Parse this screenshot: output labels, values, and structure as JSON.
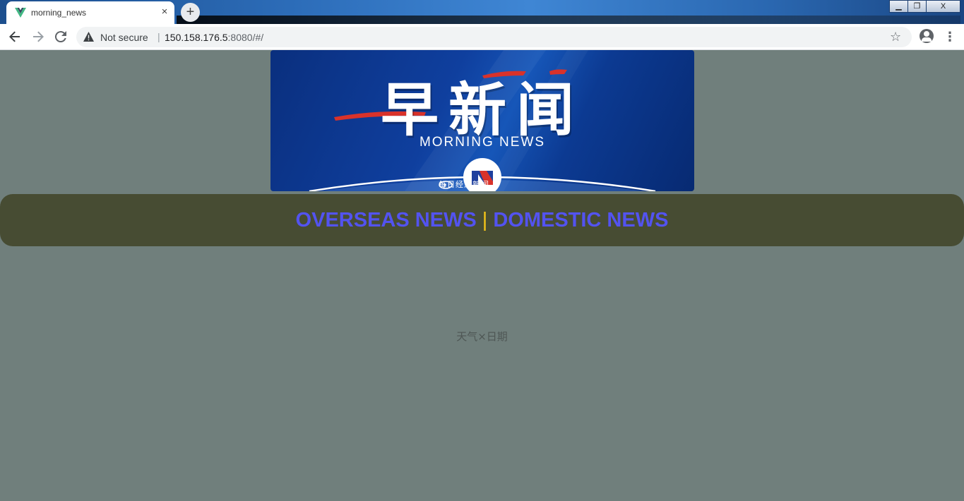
{
  "browser": {
    "tab_title": "morning_news",
    "tab_close": "×",
    "new_tab": "+",
    "window_controls": {
      "minimize": "▁",
      "restore": "❐",
      "close": "X"
    },
    "security_label": "Not secure",
    "separator": "|",
    "url_host": "150.158.176.5",
    "url_rest": ":8080/#/",
    "icons": [
      "vue-favicon-icon",
      "back-arrow-icon",
      "forward-arrow-icon",
      "reload-icon",
      "warning-icon",
      "bookmark-star-icon",
      "profile-icon",
      "menu-dots-icon"
    ]
  },
  "banner": {
    "title_cn": "早新闻",
    "title_en": "MORNING NEWS",
    "source": "每日经济新闻",
    "colors": {
      "background": "#0f3f9e",
      "accent_red": "#d9322a"
    }
  },
  "nav": {
    "overseas": "OVERSEAS NEWS",
    "divider": "|",
    "domestic": "DOMESTIC NEWS",
    "colors": {
      "bar": "#474c33",
      "link": "#5353f0",
      "divider": "#f5c518"
    }
  },
  "weather": {
    "text": "天气×日期"
  },
  "page": {
    "background": "#707f7c"
  }
}
